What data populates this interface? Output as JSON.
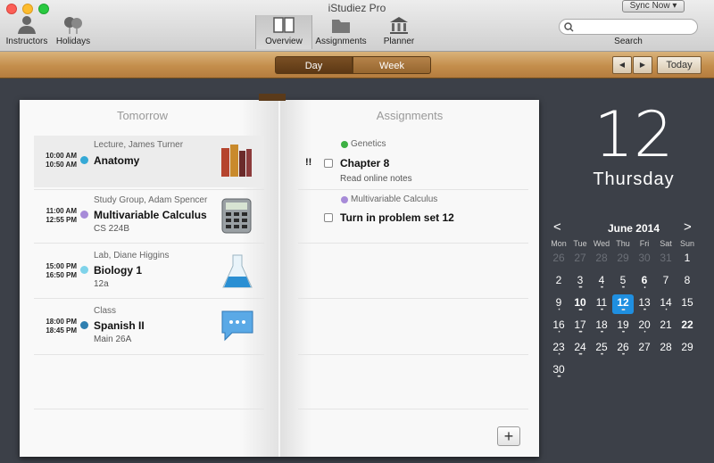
{
  "window": {
    "title": "iStudiez Pro",
    "sync_label": "Sync Now"
  },
  "toolbar": {
    "instructors": "Instructors",
    "holidays": "Holidays",
    "overview": "Overview",
    "assignments": "Assignments",
    "planner": "Planner",
    "search_label": "Search",
    "search_placeholder": ""
  },
  "viewbar": {
    "day": "Day",
    "week": "Week",
    "prev": "◀",
    "next": "▶",
    "today": "Today"
  },
  "schedule": {
    "header": "Tomorrow",
    "items": [
      {
        "start": "10:00 AM",
        "end": "10:50 AM",
        "subtitle": "Lecture, James Turner",
        "title": "Anatomy",
        "room": "",
        "dot": "#35a9d6",
        "icon": "books-icon"
      },
      {
        "start": "11:00 AM",
        "end": "12:55 PM",
        "subtitle": "Study Group, Adam Spencer",
        "title": "Multivariable Calculus",
        "room": "CS 224B",
        "dot": "#a78bd8",
        "icon": "calculator-icon"
      },
      {
        "start": "15:00 PM",
        "end": "16:50 PM",
        "subtitle": "Lab, Diane Higgins",
        "title": "Biology 1",
        "room": "12a",
        "dot": "#7fd3ea",
        "icon": "flask-icon"
      },
      {
        "start": "18:00 PM",
        "end": "18:45 PM",
        "subtitle": "Class",
        "title": "Spanish II",
        "room": "Main 26A",
        "dot": "#2f7fb0",
        "icon": "speech-bubble-icon"
      }
    ]
  },
  "assignments": {
    "header": "Assignments",
    "items": [
      {
        "course": "Genetics",
        "course_color": "#3cb043",
        "priority": "!!",
        "title": "Chapter 8",
        "note": "Read online notes"
      },
      {
        "course": "Multivariable Calculus",
        "course_color": "#a78bd8",
        "priority": "",
        "title": "Turn in problem set 12",
        "note": ""
      }
    ],
    "add_label": "+"
  },
  "date_panel": {
    "day_number": "12",
    "weekday": "Thursday",
    "month_title": "June 2014",
    "prev_arrow": "<",
    "next_arrow": ">",
    "weekdays": [
      "Mon",
      "Tue",
      "Wed",
      "Thu",
      "Fri",
      "Sat",
      "Sun"
    ],
    "rows": [
      [
        "26",
        "27",
        "28",
        "29",
        "30",
        "31",
        "1"
      ],
      [
        "2",
        "3",
        "4",
        "5",
        "6",
        "7",
        "8"
      ],
      [
        "9",
        "10",
        "11",
        "12",
        "13",
        "14",
        "15"
      ],
      [
        "16",
        "17",
        "18",
        "19",
        "20",
        "21",
        "22"
      ],
      [
        "23",
        "24",
        "25",
        "26",
        "27",
        "28",
        "29"
      ],
      [
        "30",
        "",
        "",
        "",
        "",
        "",
        ""
      ]
    ]
  }
}
